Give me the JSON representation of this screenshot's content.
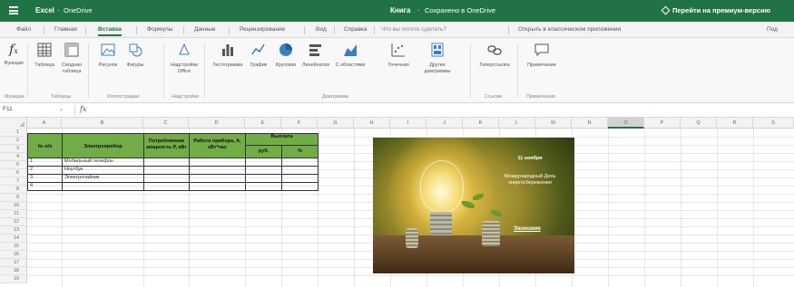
{
  "titlebar": {
    "app": "Excel",
    "separator": "·",
    "location": "OneDrive",
    "document": "Книга",
    "doc_separator": "·",
    "saved_status": "Сохранено в OneDrive",
    "preview_link": "Перейти на премиум-версию",
    "brand_color": "#217346"
  },
  "menu": {
    "tabs": [
      "Файл",
      "Главная",
      "Вставка",
      "Формулы",
      "Данные",
      "Рецензирование",
      "Вид",
      "Справка"
    ],
    "active_tab": "Вставка",
    "search_placeholder": "Что вы хотите сделать?",
    "open_desktop": "Открыть в классическом приложении",
    "share": "Под"
  },
  "ribbon": {
    "buttons": [
      {
        "label": "Функция",
        "icon": "function-icon"
      },
      {
        "label": "Таблица",
        "icon": "table-icon"
      },
      {
        "label": "Сводная таблица",
        "icon": "pivot-table-icon"
      },
      {
        "label": "Рисунок",
        "icon": "picture-icon"
      },
      {
        "label": "Фигуры",
        "icon": "shapes-icon"
      },
      {
        "label": "Надстройки Office",
        "icon": "addins-icon"
      },
      {
        "label": "Гистограмма",
        "icon": "bar-chart-icon"
      },
      {
        "label": "График",
        "icon": "line-chart-icon"
      },
      {
        "label": "Круговая",
        "icon": "pie-chart-icon"
      },
      {
        "label": "Линейчатая",
        "icon": "horizontal-bar-icon"
      },
      {
        "label": "С областями",
        "icon": "area-chart-icon"
      },
      {
        "label": "Точечная",
        "icon": "scatter-chart-icon"
      },
      {
        "label": "Другие диаграммы",
        "icon": "more-charts-icon"
      },
      {
        "label": "Гиперссылка",
        "icon": "link-icon"
      },
      {
        "label": "Примечание",
        "icon": "comment-icon"
      }
    ],
    "groups": [
      "Функции",
      "Таблицы",
      "Иллюстрации",
      "Надстройки",
      "Диаграммы",
      "Ссылки",
      "Примечания"
    ]
  },
  "formula_bar": {
    "name_box": "F11",
    "fx": "fx",
    "value": ""
  },
  "grid": {
    "columns": [
      "A",
      "B",
      "C",
      "D",
      "E",
      "F",
      "G",
      "H",
      "I",
      "J",
      "K",
      "L",
      "M",
      "N",
      "O",
      "P",
      "Q",
      "R",
      "S"
    ],
    "selected_column": "O",
    "rows": [
      "1",
      "2",
      "3",
      "4",
      "5",
      "6",
      "7",
      "8",
      "9",
      "10",
      "11",
      "12",
      "13",
      "14",
      "15",
      "16",
      "17",
      "18",
      "19"
    ]
  },
  "table": {
    "header_color": "#70ad47",
    "headers": {
      "num": "№ п/п",
      "device": "Электроприбор",
      "power": "Потребляемая мощность Р, кВт",
      "work": "Работа прибора, А, кВт*час",
      "pay": "Выплата",
      "pay_sub1": "руб.",
      "pay_sub2": "%"
    },
    "rows": [
      {
        "num": "1",
        "device": "Мобильный телефон"
      },
      {
        "num": "2",
        "device": "Ноутбук"
      },
      {
        "num": "3",
        "device": "Электрочайник"
      },
      {
        "num": "4",
        "device": ""
      }
    ]
  },
  "image": {
    "text_lines": [
      "11 ноября",
      "Международный День энергосбережения",
      ""
    ],
    "link": "Экономия"
  }
}
